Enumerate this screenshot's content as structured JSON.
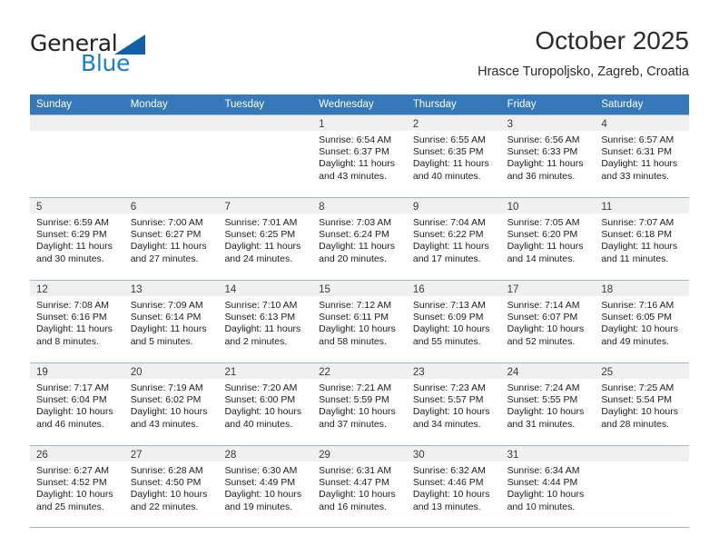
{
  "brand": {
    "word_one": "General",
    "word_two": "Blue",
    "triangle_color": "#1060a8",
    "blue_text_color": "#1a7ec6"
  },
  "header": {
    "title": "October 2025",
    "subtitle": "Hrasce Turopoljsko, Zagreb, Croatia"
  },
  "theme": {
    "header_row_bg": "#3579b8",
    "daynum_band_bg": "#f0f0f0",
    "grid_line": "#9fb6cc"
  },
  "weekday_headers": [
    "Sunday",
    "Monday",
    "Tuesday",
    "Wednesday",
    "Thursday",
    "Friday",
    "Saturday"
  ],
  "weeks": [
    [
      {
        "day": "",
        "lines": []
      },
      {
        "day": "",
        "lines": []
      },
      {
        "day": "",
        "lines": []
      },
      {
        "day": "1",
        "lines": [
          "Sunrise: 6:54 AM",
          "Sunset: 6:37 PM",
          "Daylight: 11 hours",
          "and 43 minutes."
        ]
      },
      {
        "day": "2",
        "lines": [
          "Sunrise: 6:55 AM",
          "Sunset: 6:35 PM",
          "Daylight: 11 hours",
          "and 40 minutes."
        ]
      },
      {
        "day": "3",
        "lines": [
          "Sunrise: 6:56 AM",
          "Sunset: 6:33 PM",
          "Daylight: 11 hours",
          "and 36 minutes."
        ]
      },
      {
        "day": "4",
        "lines": [
          "Sunrise: 6:57 AM",
          "Sunset: 6:31 PM",
          "Daylight: 11 hours",
          "and 33 minutes."
        ]
      }
    ],
    [
      {
        "day": "5",
        "lines": [
          "Sunrise: 6:59 AM",
          "Sunset: 6:29 PM",
          "Daylight: 11 hours",
          "and 30 minutes."
        ]
      },
      {
        "day": "6",
        "lines": [
          "Sunrise: 7:00 AM",
          "Sunset: 6:27 PM",
          "Daylight: 11 hours",
          "and 27 minutes."
        ]
      },
      {
        "day": "7",
        "lines": [
          "Sunrise: 7:01 AM",
          "Sunset: 6:25 PM",
          "Daylight: 11 hours",
          "and 24 minutes."
        ]
      },
      {
        "day": "8",
        "lines": [
          "Sunrise: 7:03 AM",
          "Sunset: 6:24 PM",
          "Daylight: 11 hours",
          "and 20 minutes."
        ]
      },
      {
        "day": "9",
        "lines": [
          "Sunrise: 7:04 AM",
          "Sunset: 6:22 PM",
          "Daylight: 11 hours",
          "and 17 minutes."
        ]
      },
      {
        "day": "10",
        "lines": [
          "Sunrise: 7:05 AM",
          "Sunset: 6:20 PM",
          "Daylight: 11 hours",
          "and 14 minutes."
        ]
      },
      {
        "day": "11",
        "lines": [
          "Sunrise: 7:07 AM",
          "Sunset: 6:18 PM",
          "Daylight: 11 hours",
          "and 11 minutes."
        ]
      }
    ],
    [
      {
        "day": "12",
        "lines": [
          "Sunrise: 7:08 AM",
          "Sunset: 6:16 PM",
          "Daylight: 11 hours",
          "and 8 minutes."
        ]
      },
      {
        "day": "13",
        "lines": [
          "Sunrise: 7:09 AM",
          "Sunset: 6:14 PM",
          "Daylight: 11 hours",
          "and 5 minutes."
        ]
      },
      {
        "day": "14",
        "lines": [
          "Sunrise: 7:10 AM",
          "Sunset: 6:13 PM",
          "Daylight: 11 hours",
          "and 2 minutes."
        ]
      },
      {
        "day": "15",
        "lines": [
          "Sunrise: 7:12 AM",
          "Sunset: 6:11 PM",
          "Daylight: 10 hours",
          "and 58 minutes."
        ]
      },
      {
        "day": "16",
        "lines": [
          "Sunrise: 7:13 AM",
          "Sunset: 6:09 PM",
          "Daylight: 10 hours",
          "and 55 minutes."
        ]
      },
      {
        "day": "17",
        "lines": [
          "Sunrise: 7:14 AM",
          "Sunset: 6:07 PM",
          "Daylight: 10 hours",
          "and 52 minutes."
        ]
      },
      {
        "day": "18",
        "lines": [
          "Sunrise: 7:16 AM",
          "Sunset: 6:05 PM",
          "Daylight: 10 hours",
          "and 49 minutes."
        ]
      }
    ],
    [
      {
        "day": "19",
        "lines": [
          "Sunrise: 7:17 AM",
          "Sunset: 6:04 PM",
          "Daylight: 10 hours",
          "and 46 minutes."
        ]
      },
      {
        "day": "20",
        "lines": [
          "Sunrise: 7:19 AM",
          "Sunset: 6:02 PM",
          "Daylight: 10 hours",
          "and 43 minutes."
        ]
      },
      {
        "day": "21",
        "lines": [
          "Sunrise: 7:20 AM",
          "Sunset: 6:00 PM",
          "Daylight: 10 hours",
          "and 40 minutes."
        ]
      },
      {
        "day": "22",
        "lines": [
          "Sunrise: 7:21 AM",
          "Sunset: 5:59 PM",
          "Daylight: 10 hours",
          "and 37 minutes."
        ]
      },
      {
        "day": "23",
        "lines": [
          "Sunrise: 7:23 AM",
          "Sunset: 5:57 PM",
          "Daylight: 10 hours",
          "and 34 minutes."
        ]
      },
      {
        "day": "24",
        "lines": [
          "Sunrise: 7:24 AM",
          "Sunset: 5:55 PM",
          "Daylight: 10 hours",
          "and 31 minutes."
        ]
      },
      {
        "day": "25",
        "lines": [
          "Sunrise: 7:25 AM",
          "Sunset: 5:54 PM",
          "Daylight: 10 hours",
          "and 28 minutes."
        ]
      }
    ],
    [
      {
        "day": "26",
        "lines": [
          "Sunrise: 6:27 AM",
          "Sunset: 4:52 PM",
          "Daylight: 10 hours",
          "and 25 minutes."
        ]
      },
      {
        "day": "27",
        "lines": [
          "Sunrise: 6:28 AM",
          "Sunset: 4:50 PM",
          "Daylight: 10 hours",
          "and 22 minutes."
        ]
      },
      {
        "day": "28",
        "lines": [
          "Sunrise: 6:30 AM",
          "Sunset: 4:49 PM",
          "Daylight: 10 hours",
          "and 19 minutes."
        ]
      },
      {
        "day": "29",
        "lines": [
          "Sunrise: 6:31 AM",
          "Sunset: 4:47 PM",
          "Daylight: 10 hours",
          "and 16 minutes."
        ]
      },
      {
        "day": "30",
        "lines": [
          "Sunrise: 6:32 AM",
          "Sunset: 4:46 PM",
          "Daylight: 10 hours",
          "and 13 minutes."
        ]
      },
      {
        "day": "31",
        "lines": [
          "Sunrise: 6:34 AM",
          "Sunset: 4:44 PM",
          "Daylight: 10 hours",
          "and 10 minutes."
        ]
      },
      {
        "day": "",
        "lines": []
      }
    ]
  ]
}
